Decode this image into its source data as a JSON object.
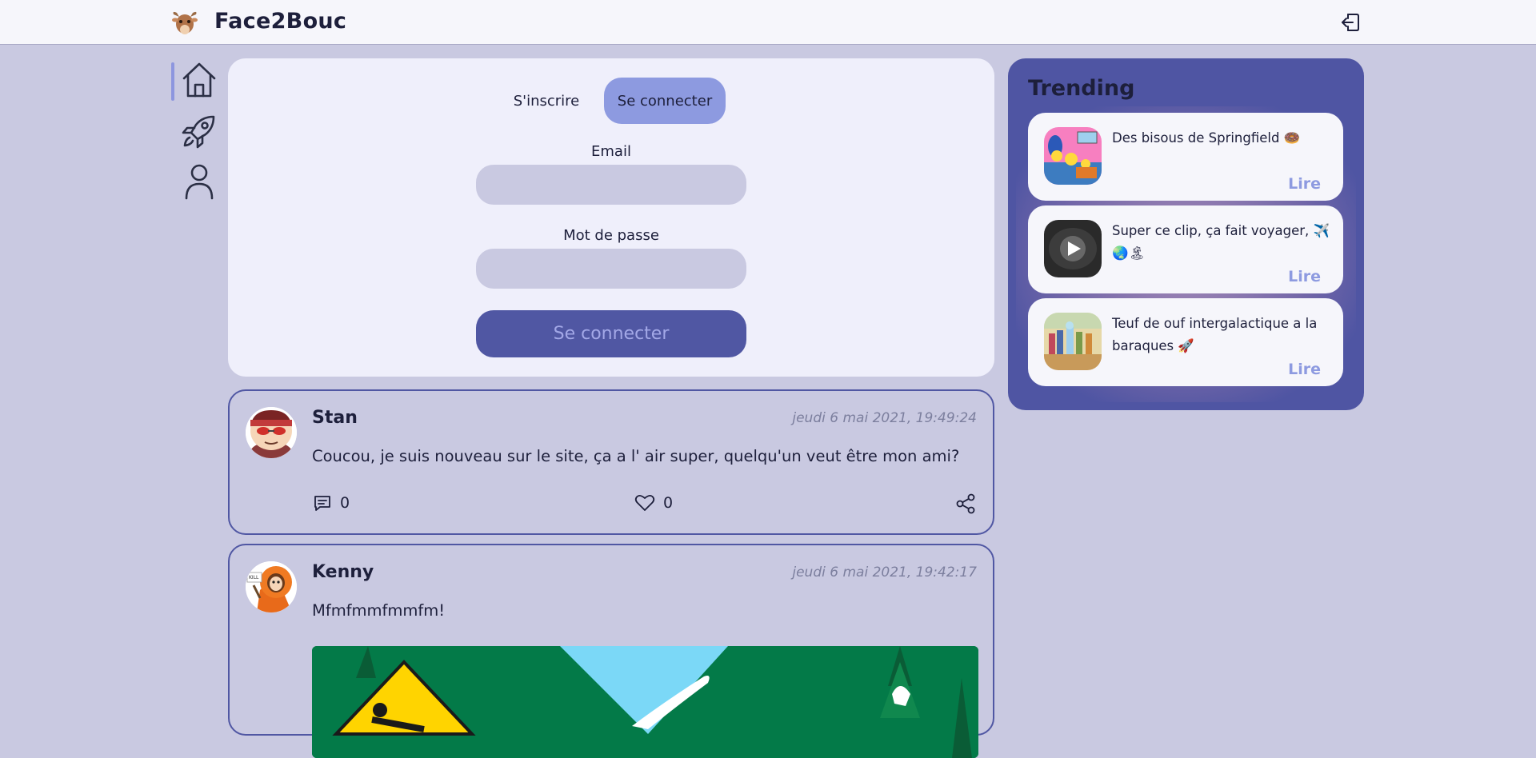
{
  "header": {
    "brand": "Face2Bouc",
    "brand_icon": "goat-head-icon",
    "logout_icon": "logout-icon"
  },
  "nav": {
    "items": [
      {
        "name": "home",
        "icon": "home-icon",
        "active": true
      },
      {
        "name": "discover",
        "icon": "rocket-icon",
        "active": false
      },
      {
        "name": "profile",
        "icon": "user-icon",
        "active": false
      }
    ]
  },
  "auth": {
    "tabs": [
      {
        "label": "S'inscrire",
        "active": false
      },
      {
        "label": "Se connecter",
        "active": true
      }
    ],
    "email_label": "Email",
    "email_value": "",
    "password_label": "Mot de passe",
    "password_value": "",
    "submit_label": "Se connecter"
  },
  "posts": [
    {
      "author": "Stan",
      "date": "jeudi 6 mai 2021, 19:49:24",
      "text": "Coucou, je suis nouveau sur le site, ça a l' air super, quelqu'un veut être mon ami?",
      "comments": "0",
      "likes": "0"
    },
    {
      "author": "Kenny",
      "date": "jeudi 6 mai 2021, 19:42:17",
      "text": "Mfmfmmfmmfm!"
    }
  ],
  "trending": {
    "title": "Trending",
    "items": [
      {
        "text": "Des bisous de Springfield 🍩",
        "action": "Lire"
      },
      {
        "text": "Super ce clip, ça fait voyager, ✈️🌏🏝",
        "action": "Lire"
      },
      {
        "text": "Teuf de ouf intergalactique a la baraques 🚀",
        "action": "Lire"
      }
    ]
  },
  "colors": {
    "background": "#c9c9e1",
    "card": "#efeffb",
    "accent": "#5057a3",
    "accent_light": "#8d9ae0",
    "text": "#1d1f3b"
  }
}
